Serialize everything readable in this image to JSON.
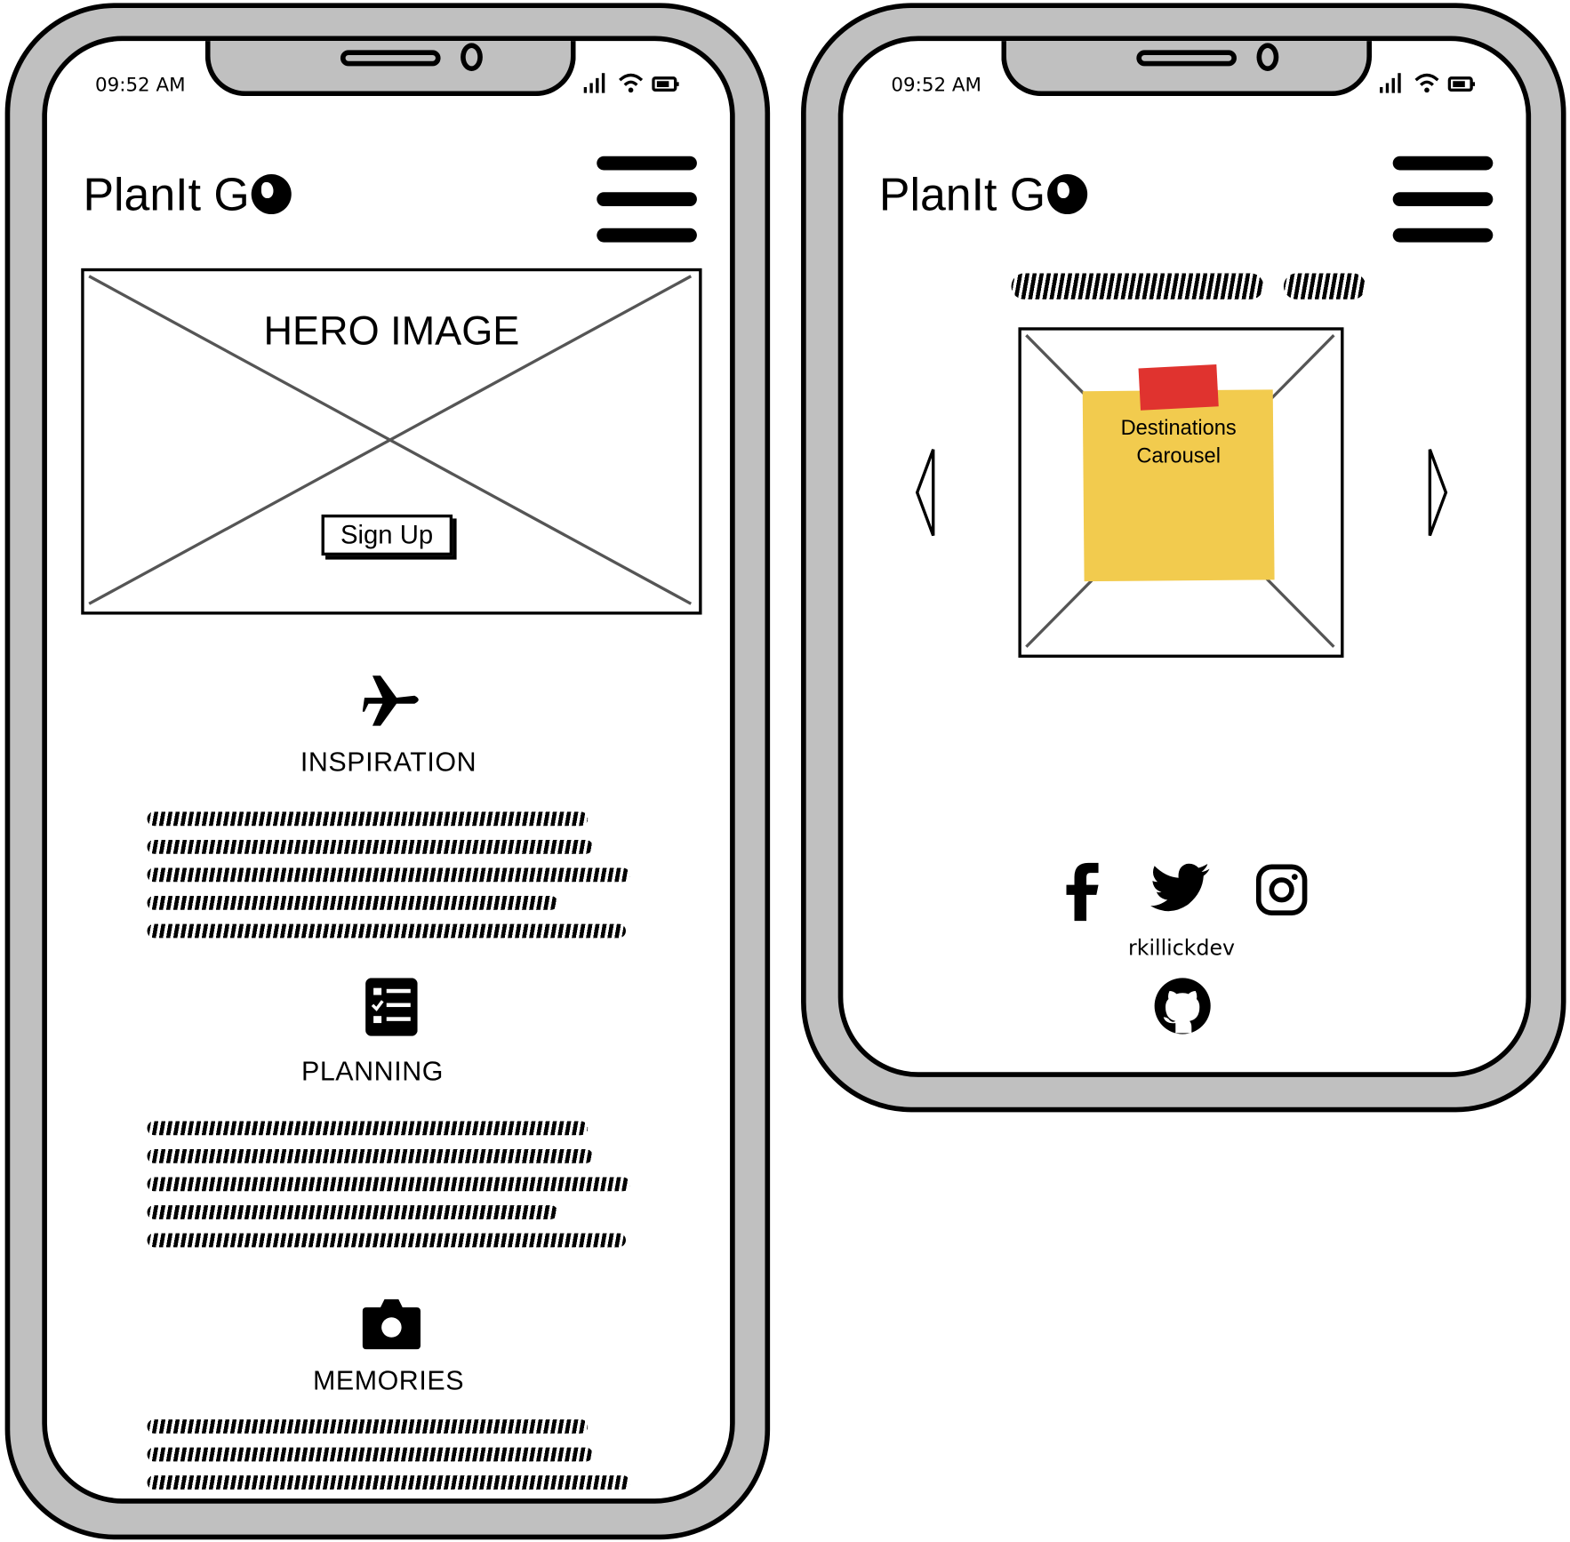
{
  "status_bar": {
    "time": "09:52 AM"
  },
  "header": {
    "logo_text": "PlanIt G"
  },
  "home": {
    "hero": {
      "title": "HERO IMAGE",
      "cta_label": "Sign Up"
    },
    "sections": [
      {
        "title": "INSPIRATION",
        "icon": "airplane-icon"
      },
      {
        "title": "PLANNING",
        "icon": "checklist-icon"
      },
      {
        "title": "MEMORIES",
        "icon": "camera-icon"
      }
    ]
  },
  "destinations": {
    "carousel_note": "Destinations Carousel",
    "sticky_color": "#f2cb4e",
    "tape_color": "#e0332f",
    "social": {
      "icons": [
        "facebook-icon",
        "twitter-icon",
        "instagram-icon",
        "github-icon"
      ],
      "handle": "rkillickdev"
    }
  }
}
